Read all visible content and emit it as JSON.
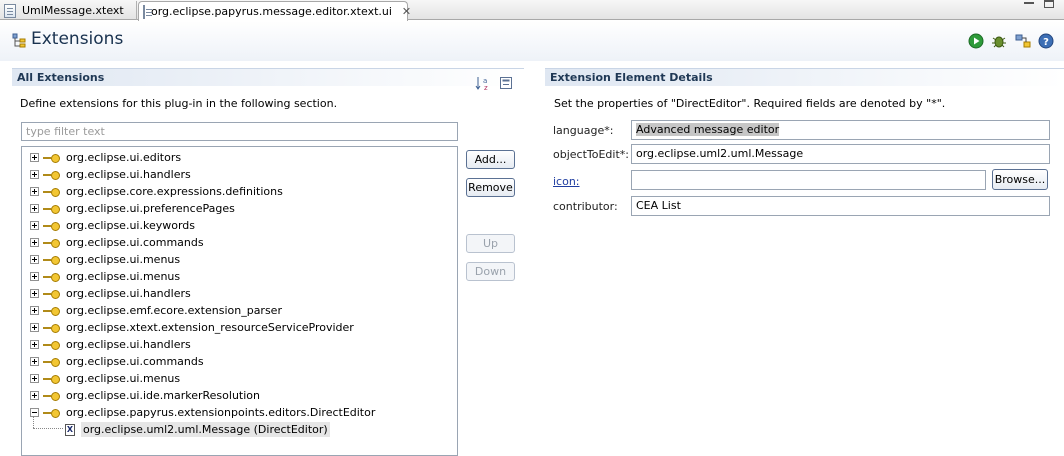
{
  "tabs": [
    {
      "label": "UmlMessage.xtext",
      "active": false
    },
    {
      "label": "org.eclipse.papyrus.message.editor.xtext.ui",
      "active": true
    }
  ],
  "header": {
    "title": "Extensions"
  },
  "left": {
    "title": "All Extensions",
    "description": "Define extensions for this plug-in in the following section.",
    "filter_placeholder": "type filter text",
    "tree": [
      "org.eclipse.ui.editors",
      "org.eclipse.ui.handlers",
      "org.eclipse.core.expressions.definitions",
      "org.eclipse.ui.preferencePages",
      "org.eclipse.ui.keywords",
      "org.eclipse.ui.commands",
      "org.eclipse.ui.menus",
      "org.eclipse.ui.menus",
      "org.eclipse.ui.handlers",
      "org.eclipse.emf.ecore.extension_parser",
      "org.eclipse.xtext.extension_resourceServiceProvider",
      "org.eclipse.ui.handlers",
      "org.eclipse.ui.commands",
      "org.eclipse.ui.menus",
      "org.eclipse.ui.ide.markerResolution",
      "org.eclipse.papyrus.extensionpoints.editors.DirectEditor"
    ],
    "child": "org.eclipse.uml2.uml.Message (DirectEditor)",
    "buttons": {
      "add": "Add...",
      "remove": "Remove",
      "up": "Up",
      "down": "Down"
    }
  },
  "right": {
    "title": "Extension Element Details",
    "description": "Set the properties of \"DirectEditor\". Required fields are denoted by \"*\".",
    "fields": [
      {
        "label": "language*:",
        "value": "Advanced message editor"
      },
      {
        "label": "objectToEdit*:",
        "value": "org.eclipse.uml2.uml.Message"
      },
      {
        "label": "icon:",
        "value": ""
      },
      {
        "label": "contributor:",
        "value": "CEA List"
      }
    ],
    "browse": "Browse..."
  }
}
